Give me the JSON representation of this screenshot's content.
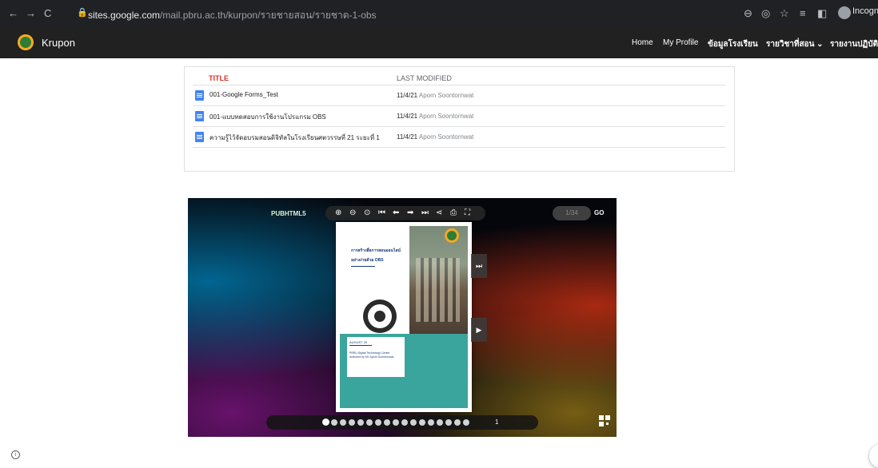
{
  "browser": {
    "url_host": "sites.google.com",
    "url_path": "/mail.pbru.ac.th/kurpon/รายชายสอน/รายชาต-1-obs",
    "incognito_label": "Incogn",
    "icons": [
      "back-icon",
      "forward-icon",
      "reload-icon",
      "lock-icon",
      "zoom-icon",
      "eye-off-icon",
      "star-icon",
      "reading-list-icon",
      "side-panel-icon",
      "incognito-icon"
    ]
  },
  "site": {
    "name": "Krupon",
    "nav": [
      "Home",
      "My Profile",
      "ข้อมูลโรงเรียน",
      "รายวิชาที่สอน ⌄",
      "รายงานปฏิบัติง"
    ]
  },
  "files": {
    "headers": {
      "title": "TITLE",
      "modified": "LAST MODIFIED"
    },
    "rows": [
      {
        "name": "001-Google Forms_Test",
        "date": "11/4/21",
        "author": "Aporn Soontornwat"
      },
      {
        "name": "001-แบบทดสอบการใช้งานโปรแกรม OBS",
        "date": "11/4/21",
        "author": "Aporn Soontornwat"
      },
      {
        "name": "ความรู้ไว้จัดอบรมสอนดิจิทัลในโรงเรียนศตวรรษที่ 21 ระยะที่ 1",
        "date": "11/4/21",
        "author": "Aporn Soontornwat"
      }
    ]
  },
  "flipbook": {
    "brand": "PUBHTML5",
    "toolbar": [
      "⊕",
      "⊖",
      "⊙",
      "⏮",
      "⬅",
      "➡",
      "⏭",
      "⋖",
      "⎙",
      "⛶"
    ],
    "page_input": "1/34",
    "go_label": "GO",
    "page_title_1": "การสร้างสื่อการสอนออนไลน์",
    "page_title_2": "อย่างง่ายด้วย OBS",
    "page_date": "AUGUST 20",
    "page_sub_1": "PBRU Digital Technology Center",
    "page_sub_2": "Authored by Mr. Aporn Soontornwat",
    "current_page": "1",
    "dot_count": 17,
    "arrow_next": "▶",
    "arrow_last": "⏭"
  },
  "colors": {
    "chrome": "#202124",
    "header": "#212121",
    "title_red": "#d93025",
    "teal": "#3aa59c"
  }
}
